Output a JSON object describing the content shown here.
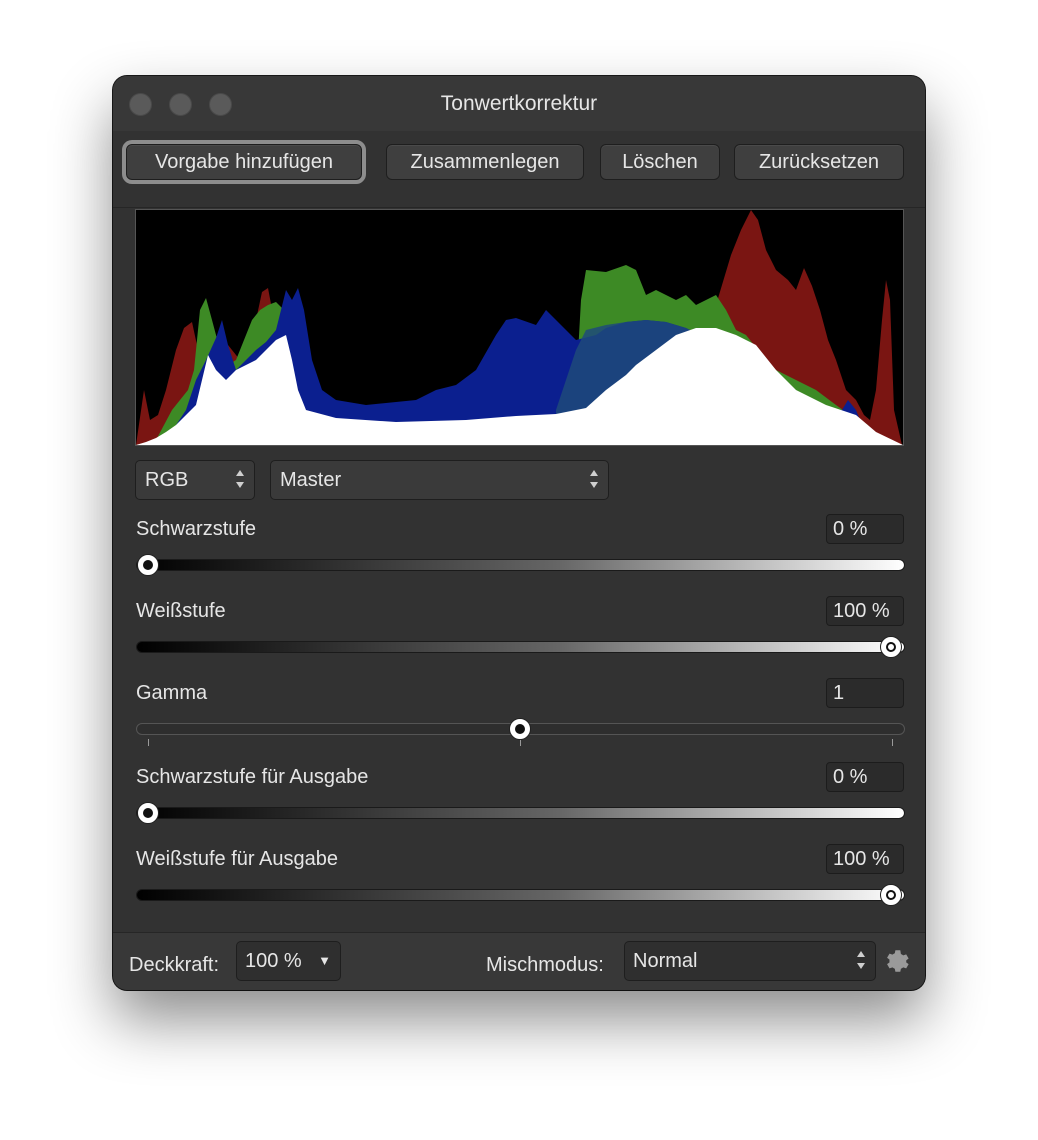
{
  "window": {
    "title": "Tonwertkorrektur"
  },
  "toolbar": {
    "add_preset": "Vorgabe hinzufügen",
    "merge": "Zusammenlegen",
    "delete": "Löschen",
    "reset": "Zurücksetzen"
  },
  "histogram": {
    "colors": {
      "red": "#7a1512",
      "green": "#3d8a25",
      "blue": "#0b1f8f",
      "white": "#ffffff"
    }
  },
  "channel_select": {
    "value": "RGB"
  },
  "mode_select": {
    "value": "Master"
  },
  "sliders": [
    {
      "label": "Schwarzstufe",
      "value": "0 %",
      "level": 0
    },
    {
      "label": "Weißstufe",
      "value": "100 %",
      "level": 1
    },
    {
      "label": "Gamma",
      "value": "1",
      "level": 0.5
    },
    {
      "label": "Schwarzstufe für Ausgabe",
      "value": "0 %",
      "level": 0
    },
    {
      "label": "Weißstufe für Ausgabe",
      "value": "100 %",
      "level": 1
    }
  ],
  "footer": {
    "opacity_label": "Deckkraft:",
    "opacity_value": "100 %",
    "blend_label": "Mischmodus:",
    "blend_value": "Normal",
    "settings_icon": "gear-icon"
  }
}
